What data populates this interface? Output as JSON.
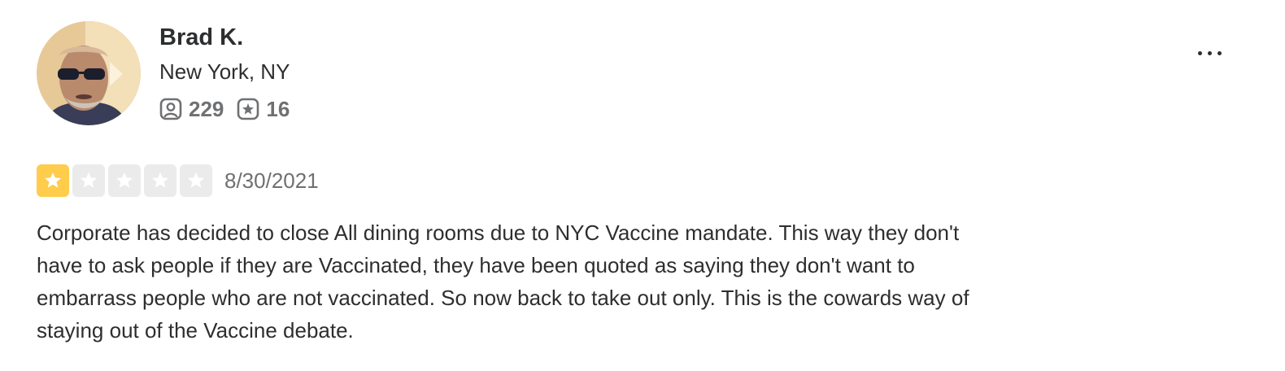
{
  "user": {
    "name": "Brad K.",
    "location": "New York, NY",
    "friends_count": "229",
    "reviews_count": "16"
  },
  "review": {
    "rating": 1,
    "max_rating": 5,
    "date": "8/30/2021",
    "text": "Corporate has decided to close All dining rooms due to NYC Vaccine mandate. This way they don't\nhave to ask people if they are Vaccinated, they have been quoted as saying they don't want to\nembarrass people who are not vaccinated.  So now back to take out only. This is the cowards way of\nstaying out of the Vaccine debate."
  },
  "icons": {
    "friends": "friends-icon",
    "reviews": "review-star-icon",
    "more": "more-options-icon"
  },
  "colors": {
    "star_filled": "#ffcc4b",
    "star_empty": "#ebebeb",
    "text": "#2d2e2f",
    "muted": "#6e7072"
  }
}
